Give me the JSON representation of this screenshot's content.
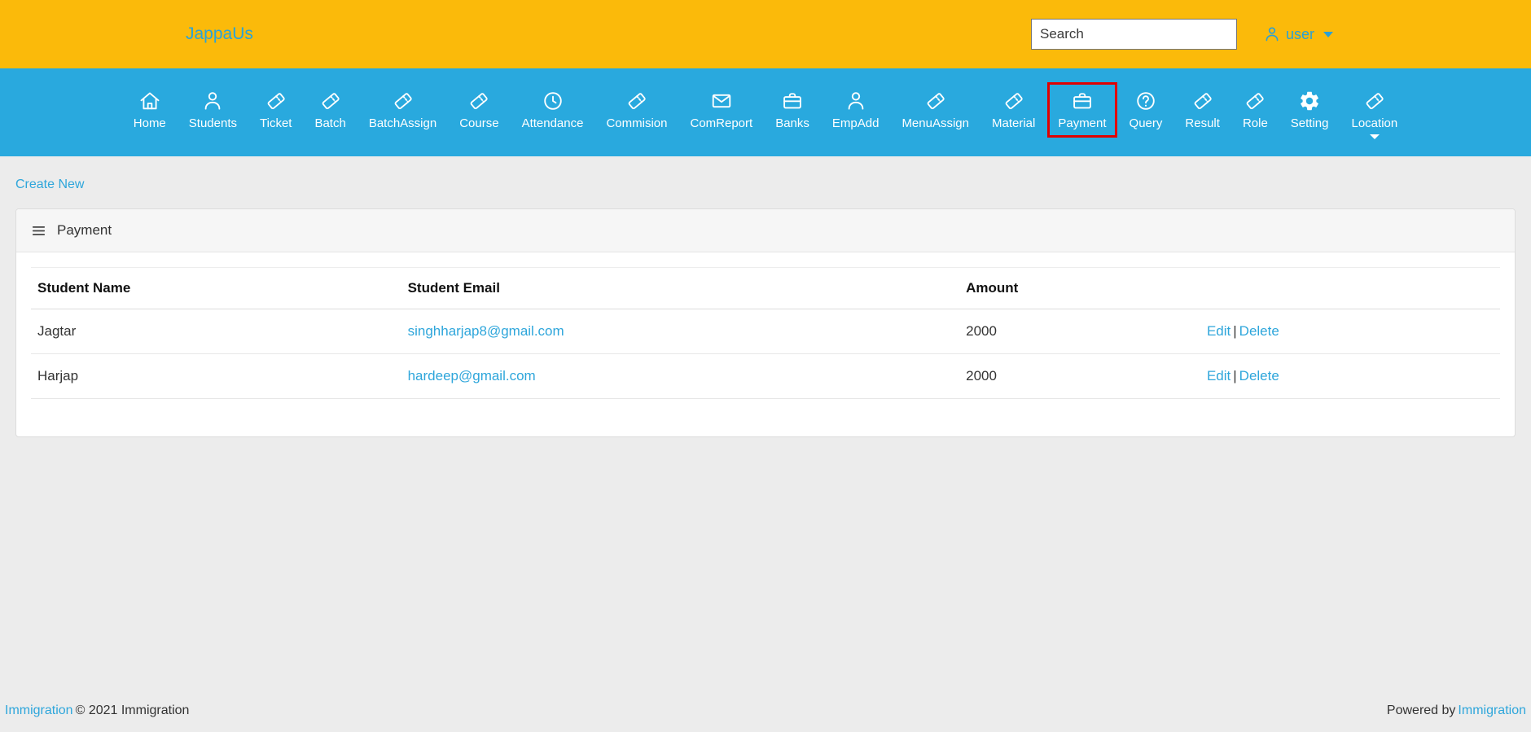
{
  "header": {
    "brand": "JappaUs",
    "search_placeholder": "Search",
    "user_label": "user"
  },
  "nav": {
    "items": [
      {
        "label": "Home",
        "icon": "home-icon"
      },
      {
        "label": "Students",
        "icon": "person-icon"
      },
      {
        "label": "Ticket",
        "icon": "ticket-icon"
      },
      {
        "label": "Batch",
        "icon": "ticket-icon"
      },
      {
        "label": "BatchAssign",
        "icon": "ticket-icon"
      },
      {
        "label": "Course",
        "icon": "ticket-icon"
      },
      {
        "label": "Attendance",
        "icon": "clock-icon"
      },
      {
        "label": "Commision",
        "icon": "ticket-icon"
      },
      {
        "label": "ComReport",
        "icon": "envelope-icon"
      },
      {
        "label": "Banks",
        "icon": "briefcase-icon"
      },
      {
        "label": "EmpAdd",
        "icon": "person-icon"
      },
      {
        "label": "MenuAssign",
        "icon": "ticket-icon"
      },
      {
        "label": "Material",
        "icon": "ticket-icon"
      },
      {
        "label": "Payment",
        "icon": "briefcase-icon",
        "highlighted": true
      },
      {
        "label": "Query",
        "icon": "question-icon"
      },
      {
        "label": "Result",
        "icon": "ticket-icon"
      },
      {
        "label": "Role",
        "icon": "ticket-icon"
      },
      {
        "label": "Setting",
        "icon": "gear-icon"
      },
      {
        "label": "Location",
        "icon": "ticket-icon",
        "has_dropdown": true
      }
    ]
  },
  "content": {
    "create_new_label": "Create New",
    "panel_title": "Payment",
    "table": {
      "headers": [
        "Student Name",
        "Student Email",
        "Amount",
        ""
      ],
      "actions_separator": "|",
      "rows": [
        {
          "name": "Jagtar",
          "email": "singhharjap8@gmail.com",
          "amount": "2000",
          "edit": "Edit",
          "delete": "Delete"
        },
        {
          "name": "Harjap",
          "email": "hardeep@gmail.com",
          "amount": "2000",
          "edit": "Edit",
          "delete": "Delete"
        }
      ]
    }
  },
  "footer": {
    "left_link": "Immigration",
    "left_text": "© 2021 Immigration",
    "right_text": "Powered by",
    "right_link": "Immigration"
  },
  "colors": {
    "header_bg": "#FBBA0A",
    "nav_bg": "#29A9DE",
    "link_blue": "#2EA6DB",
    "highlight_border": "#E00000"
  }
}
